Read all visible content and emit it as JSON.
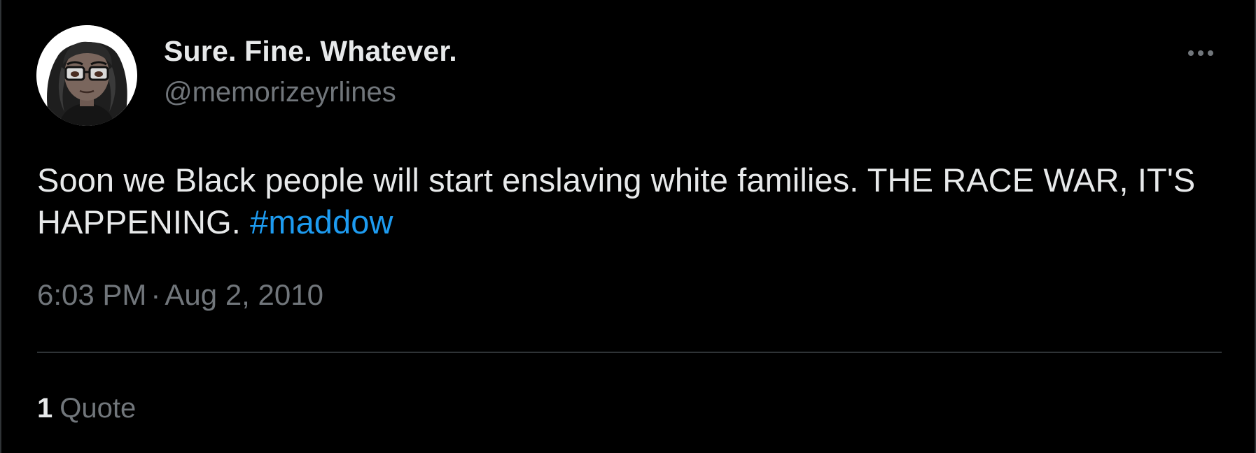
{
  "author": {
    "display_name": "Sure. Fine. Whatever.",
    "handle": "@memorizeyrlines",
    "avatar_icon": "cartoon-avatar-glasses"
  },
  "tweet": {
    "text": "Soon we Black people will start enslaving white families. THE RACE WAR, IT'S HAPPENING.",
    "hashtag": "#maddow",
    "time": "6:03 PM",
    "separator": "·",
    "date": "Aug 2, 2010"
  },
  "stats": {
    "quote_count": "1",
    "quote_label": "Quote"
  },
  "menu": {
    "more_icon": "more-horizontal-icon"
  },
  "colors": {
    "background": "#000000",
    "text": "#e7e9ea",
    "muted": "#71767b",
    "link": "#1d9bf0",
    "divider": "#2f3336"
  }
}
